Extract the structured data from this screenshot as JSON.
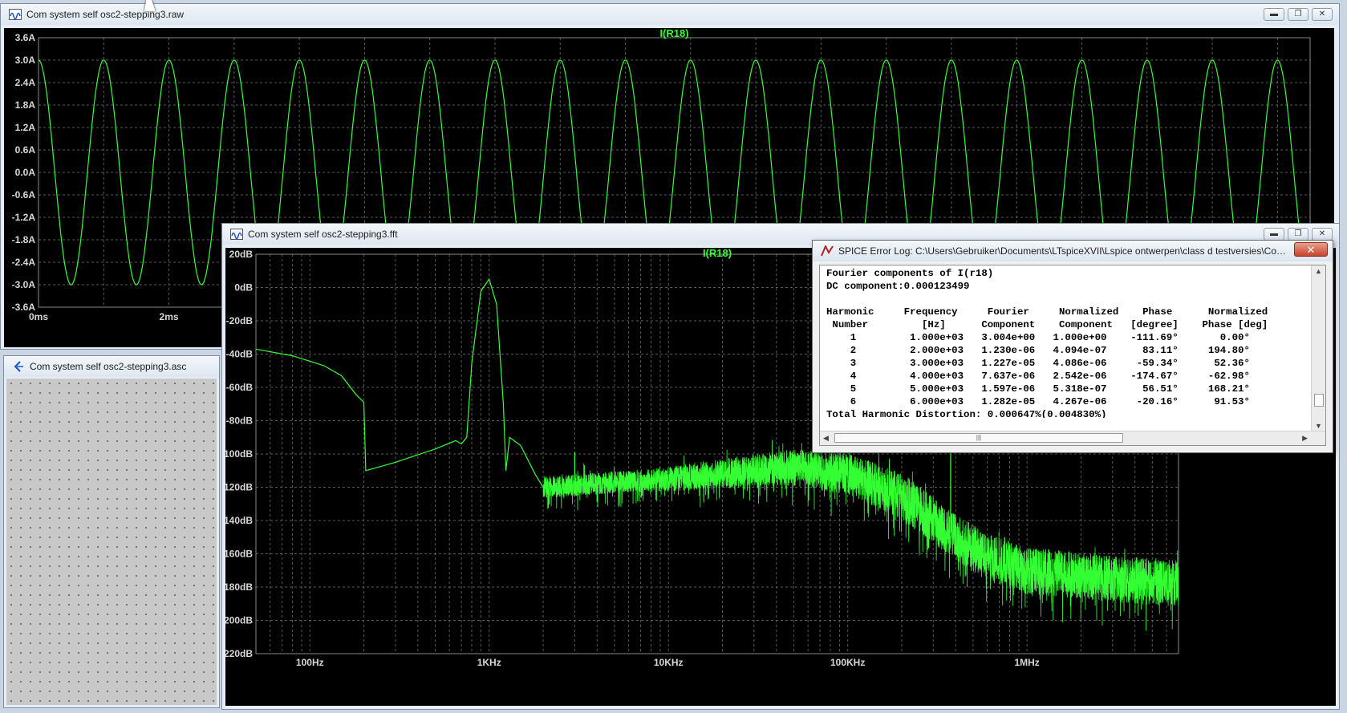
{
  "windows": {
    "raw": {
      "title": "Com system self osc2-stepping3.raw"
    },
    "asc": {
      "title": "Com system self osc2-stepping3.asc"
    },
    "fft": {
      "title": "Com system self osc2-stepping3.fft"
    },
    "errlog": {
      "title": "SPICE Error Log: C:\\Users\\Gebruiker\\Documents\\LTspiceXVII\\Lspice ontwerpen\\class d testversies\\Com sy...",
      "close_label": "✕"
    }
  },
  "window_buttons": {
    "minimize": "▬",
    "maximize": "❐",
    "close": "✕"
  },
  "chart_data": [
    {
      "type": "line",
      "title": "I(R18)",
      "xlabel": "",
      "ylabel": "",
      "x_unit": "ms",
      "y_unit": "A",
      "y_ticks": [
        "3.6A",
        "3.0A",
        "2.4A",
        "1.8A",
        "1.2A",
        "0.6A",
        "0.0A",
        "-0.6A",
        "-1.2A",
        "-1.8A",
        "-2.4A",
        "-3.0A",
        "-3.6A"
      ],
      "x_ticks": [
        "0ms",
        "2ms"
      ],
      "ylim": [
        -3.6,
        3.6
      ],
      "xlim": [
        0,
        19.5
      ],
      "grid": true,
      "trace_color": "#33ff33",
      "series": [
        {
          "name": "I(R18)",
          "frequency_hz": 1000,
          "amplitude_a": 3.0,
          "first_peak_ms": 1.0
        }
      ]
    },
    {
      "type": "line",
      "title": "I(R18)",
      "xlabel": "",
      "ylabel": "",
      "x_scale": "log",
      "xlim_hz": [
        50,
        7000000
      ],
      "ylim_db": [
        -220,
        20
      ],
      "y_ticks": [
        "20dB",
        "0dB",
        "-20dB",
        "-40dB",
        "-60dB",
        "-80dB",
        "-100dB",
        "-120dB",
        "-140dB",
        "-160dB",
        "-180dB",
        "-200dB",
        "-220dB"
      ],
      "x_ticks": [
        "100Hz",
        "1KHz",
        "10KHz",
        "100KHz",
        "1MHz"
      ],
      "grid": true,
      "trace_color": "#33ff33",
      "series": [
        {
          "name": "I(R18)",
          "x_hz": [
            50,
            80,
            120,
            150,
            180,
            200,
            205,
            300,
            500,
            650,
            700,
            750,
            800,
            900,
            1000,
            1100,
            1200,
            1240,
            1300,
            1500,
            1800,
            2000
          ],
          "y_db": [
            -37,
            -41,
            -47,
            -53,
            -64,
            -69,
            -110,
            -105,
            -97,
            -92,
            -94,
            -90,
            -45,
            -2,
            5,
            -10,
            -70,
            -110,
            -90,
            -95,
            -112,
            -120
          ],
          "noise_floor": {
            "x_hz": [
              2000,
              5000,
              10000,
              30000,
              50000,
              100000,
              200000,
              400000,
              600000,
              1000000,
              3000000,
              7000000
            ],
            "y_db": [
              -120,
              -117,
              -115,
              -110,
              -108,
              -112,
              -125,
              -150,
              -162,
              -170,
              -175,
              -178
            ]
          },
          "spurs": [
            {
              "x_hz": 3000,
              "y_db": -99
            },
            {
              "x_hz": 375000,
              "y_db": -96
            },
            {
              "x_hz": 750000,
              "y_db": -150
            },
            {
              "x_hz": 1125000,
              "y_db": -157
            },
            {
              "x_hz": 1500000,
              "y_db": -164
            }
          ]
        }
      ]
    }
  ],
  "fourier_log": {
    "lines": [
      "Fourier components of I(r18)",
      "DC component:0.000123499",
      "",
      "Harmonic     Frequency     Fourier     Normalized    Phase      Normalized",
      " Number         [Hz]      Component    Component   [degree]    Phase [deg]",
      "    1         1.000e+03   3.004e+00   1.000e+00    -111.69°       0.00°",
      "    2         2.000e+03   1.230e-06   4.094e-07      83.11°     194.80°",
      "    3         3.000e+03   1.227e-05   4.086e-06     -59.34°      52.36°",
      "    4         4.000e+03   7.637e-06   2.542e-06    -174.67°     -62.98°",
      "    5         5.000e+03   1.597e-06   5.318e-07      56.51°     168.21°",
      "    6         6.000e+03   1.282e-05   4.267e-06     -20.16°      91.53°",
      "Total Harmonic Distortion: 0.000647%(0.004830%)"
    ]
  },
  "colors": {
    "trace": "#33ff33",
    "plot_bg": "#000000",
    "grid": "#5a5a5a"
  }
}
